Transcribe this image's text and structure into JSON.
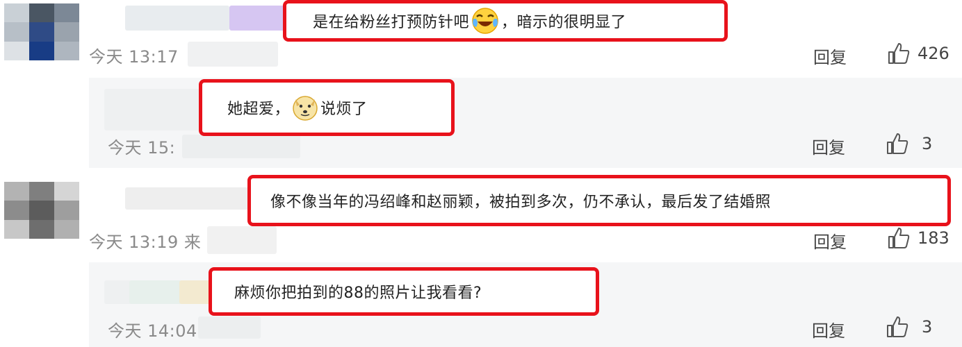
{
  "colors": {
    "highlight": "#e8121b",
    "reply_panel": "#f5f6f7",
    "meta_text": "#8a8a8a"
  },
  "comments": [
    {
      "text_a": "是在给粉丝打预防针吧",
      "emoji": "laughing-crying-emoji",
      "text_b": "，暗示的很明显了",
      "time": "今天 13:17",
      "reply_label": "回复",
      "like_count": "426"
    },
    {
      "text_a": "她超爱，",
      "emoji": "doge-emoji",
      "text_b": "说烦了",
      "time": "今天 15:",
      "reply_label": "回复",
      "like_count": "3"
    },
    {
      "text": "像不像当年的冯绍峰和赵丽颖，被拍到多次，仍不承认，最后发了结婚照",
      "time": "今天 13:19 来",
      "reply_label": "回复",
      "like_count": "183"
    },
    {
      "text": "麻烦你把拍到的88的照片让我看看?",
      "time": "今天 14:04",
      "reply_label": "回复",
      "like_count": "3"
    }
  ]
}
